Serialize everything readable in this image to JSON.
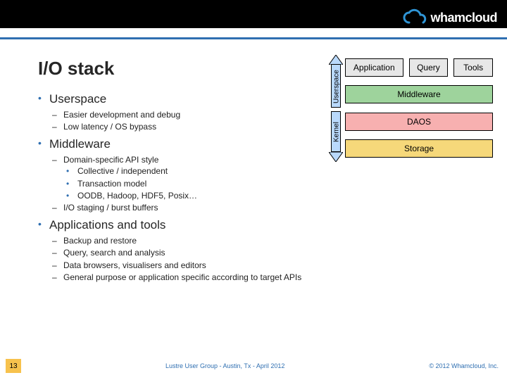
{
  "brand": "whamcloud",
  "title": "I/O stack",
  "bullets": {
    "userspace": {
      "head": "Userspace",
      "items": [
        "Easier development and debug",
        "Low latency / OS bypass"
      ]
    },
    "middleware": {
      "head": "Middleware",
      "items": [
        "Domain-specific API style",
        "I/O staging / burst buffers"
      ],
      "sub0": [
        "Collective / independent",
        "Transaction model",
        "OODB, Hadoop, HDF5, Posix…"
      ]
    },
    "apps": {
      "head": "Applications and tools",
      "items": [
        "Backup and restore",
        "Query, search and analysis",
        "Data browsers, visualisers and editors",
        "General purpose or application specific according to target APIs"
      ]
    }
  },
  "diagram": {
    "top": {
      "a": "Application",
      "b": "Query",
      "c": "Tools"
    },
    "middleware": "Middleware",
    "daos": "DAOS",
    "storage": "Storage",
    "vlabelUser": "Userspace",
    "vlabelKernel": "Kernel"
  },
  "footer": {
    "page": "13",
    "center": "Lustre User Group - Austin, Tx - April 2012",
    "right": "© 2012  Whamcloud, Inc."
  }
}
